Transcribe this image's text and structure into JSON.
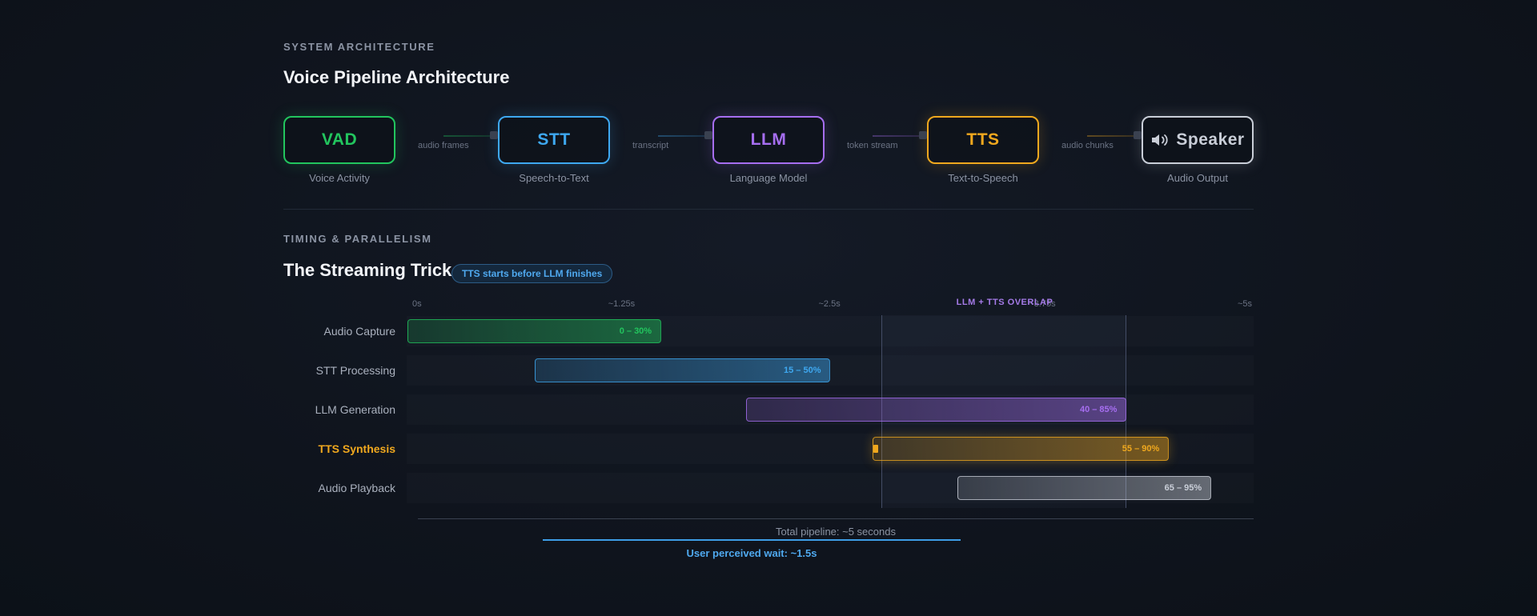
{
  "architecture": {
    "eyebrow": "SYSTEM ARCHITECTURE",
    "title": "Voice Pipeline Architecture",
    "nodes": [
      {
        "id": "vad",
        "label": "VAD",
        "caption": "Voice Activity",
        "color": "#22c55e"
      },
      {
        "id": "stt",
        "label": "STT",
        "caption": "Speech-to-Text",
        "color": "#3ea8f0"
      },
      {
        "id": "llm",
        "label": "LLM",
        "caption": "Language Model",
        "color": "#a66ef0"
      },
      {
        "id": "tts",
        "label": "TTS",
        "caption": "Text-to-Speech",
        "color": "#f0a81e"
      },
      {
        "id": "speaker",
        "label": "Speaker",
        "icon": "speaker-icon",
        "caption": "Audio Output",
        "color": "#c9ced8"
      }
    ],
    "connectors": [
      {
        "label": "audio frames"
      },
      {
        "label": "transcript"
      },
      {
        "label": "token stream"
      },
      {
        "label": "audio chunks"
      }
    ]
  },
  "timing": {
    "eyebrow": "TIMING & PARALLELISM",
    "title": "The Streaming Trick",
    "badge": "TTS starts before LLM finishes",
    "overlap_label": "LLM + TTS OVERLAP",
    "ticks": [
      "0s",
      "~1.25s",
      "~2.5s",
      "~3.75s",
      "~5s"
    ],
    "overlap_range_pct": [
      56,
      85
    ],
    "rows": [
      {
        "label": "Audio Capture",
        "range": "0 – 30%",
        "start": 0,
        "end": 30,
        "color": "#22c55e",
        "highlight": false
      },
      {
        "label": "STT Processing",
        "range": "15 – 50%",
        "start": 15,
        "end": 50,
        "color": "#3ea8f0",
        "highlight": false
      },
      {
        "label": "LLM Generation",
        "range": "40 – 85%",
        "start": 40,
        "end": 85,
        "color": "#a66ef0",
        "highlight": false
      },
      {
        "label": "TTS Synthesis",
        "range": "55 – 90%",
        "start": 55,
        "end": 90,
        "color": "#f0a81e",
        "highlight": true
      },
      {
        "label": "Audio Playback",
        "range": "65 – 95%",
        "start": 65,
        "end": 95,
        "color": "#c9ced8",
        "highlight": false
      }
    ],
    "total_text": "Total pipeline: ~5 seconds",
    "wait_text": "User perceived wait: ~1.5s"
  }
}
